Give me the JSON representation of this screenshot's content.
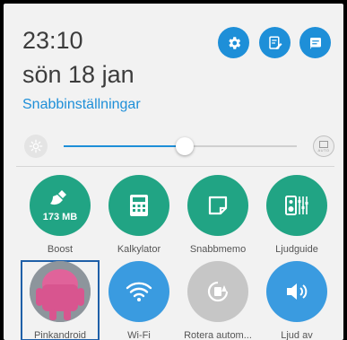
{
  "header": {
    "time": "23:10",
    "date": "sön 18 jan",
    "section_title": "Snabbinställningar"
  },
  "top_buttons": [
    {
      "icon": "settings-gear-icon"
    },
    {
      "icon": "edit-notes-icon"
    },
    {
      "icon": "message-notes-icon"
    }
  ],
  "brightness": {
    "level_fraction": 0.52,
    "auto_label": "AUTO"
  },
  "tiles_row1": [
    {
      "label": "Boost",
      "badge": "173 MB",
      "icon": "broom-icon"
    },
    {
      "label": "Kalkylator",
      "icon": "calculator-icon"
    },
    {
      "label": "Snabbmemo",
      "icon": "memo-icon"
    },
    {
      "label": "Ljudguide",
      "icon": "equalizer-icon"
    }
  ],
  "tiles_row2": [
    {
      "label": "Pinkandroid",
      "icon": "android-avatar-icon"
    },
    {
      "label": "Wi-Fi",
      "icon": "wifi-icon"
    },
    {
      "label": "Rotera autom...",
      "icon": "rotate-icon"
    },
    {
      "label": "Ljud av",
      "icon": "speaker-icon"
    }
  ],
  "colors": {
    "accent": "#1e8fd8",
    "tile_green": "#21a484",
    "tile_blue": "#3a9be0",
    "tile_disabled": "#c6c6c6"
  }
}
